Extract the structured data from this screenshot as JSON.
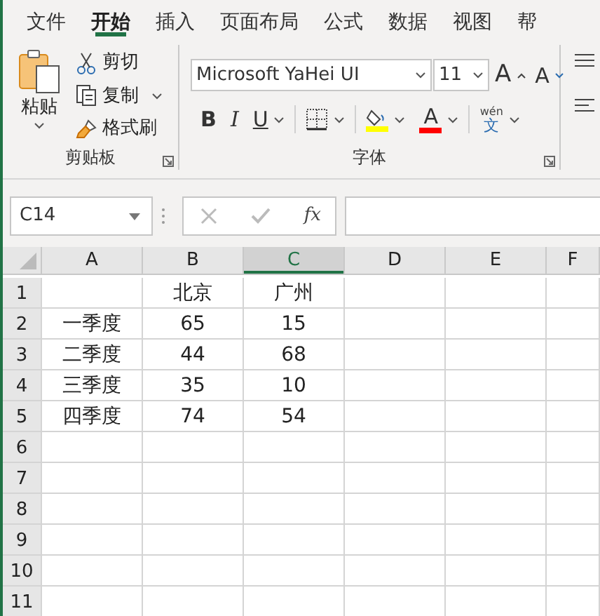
{
  "tabs": [
    {
      "label": "文件",
      "selected": false
    },
    {
      "label": "开始",
      "selected": true
    },
    {
      "label": "插入",
      "selected": false
    },
    {
      "label": "页面布局",
      "selected": false
    },
    {
      "label": "公式",
      "selected": false
    },
    {
      "label": "数据",
      "selected": false
    },
    {
      "label": "视图",
      "selected": false
    },
    {
      "label": "帮",
      "selected": false
    }
  ],
  "clipboard_group": {
    "paste_label": "粘贴",
    "commands": [
      {
        "kind": "cut",
        "label": "剪切"
      },
      {
        "kind": "copy",
        "label": "复制"
      },
      {
        "kind": "format_painter",
        "label": "格式刷"
      }
    ],
    "group_label": "剪贴板"
  },
  "font_group": {
    "font_name": "Microsoft YaHei UI",
    "font_size": "11",
    "grow_font": "A",
    "shrink_font": "A",
    "style_buttons": [
      {
        "kind": "bold",
        "label": "B"
      },
      {
        "kind": "italic",
        "label": "I"
      },
      {
        "kind": "underline",
        "label": "U"
      }
    ],
    "font_color_label": "A",
    "phonetic_top": "wén",
    "phonetic_bottom": "文",
    "group_label": "字体"
  },
  "formula_bar": {
    "name_box": "C14",
    "function_label": "fx"
  },
  "columns": [
    {
      "label": "A",
      "selected": false
    },
    {
      "label": "B",
      "selected": false
    },
    {
      "label": "C",
      "selected": true
    },
    {
      "label": "D",
      "selected": false
    },
    {
      "label": "E",
      "selected": false
    },
    {
      "label": "F",
      "selected": false
    }
  ],
  "rows": [
    {
      "label": "1",
      "cells": [
        "",
        "北京",
        "广州"
      ]
    },
    {
      "label": "2",
      "cells": [
        "一季度",
        "65",
        "15"
      ]
    },
    {
      "label": "3",
      "cells": [
        "二季度",
        "44",
        "68"
      ]
    },
    {
      "label": "4",
      "cells": [
        "三季度",
        "35",
        "10"
      ]
    },
    {
      "label": "5",
      "cells": [
        "四季度",
        "74",
        "54"
      ]
    },
    {
      "label": "6",
      "cells": []
    },
    {
      "label": "7",
      "cells": []
    },
    {
      "label": "8",
      "cells": []
    },
    {
      "label": "9",
      "cells": []
    },
    {
      "label": "10",
      "cells": []
    },
    {
      "label": "11",
      "cells": []
    }
  ]
}
